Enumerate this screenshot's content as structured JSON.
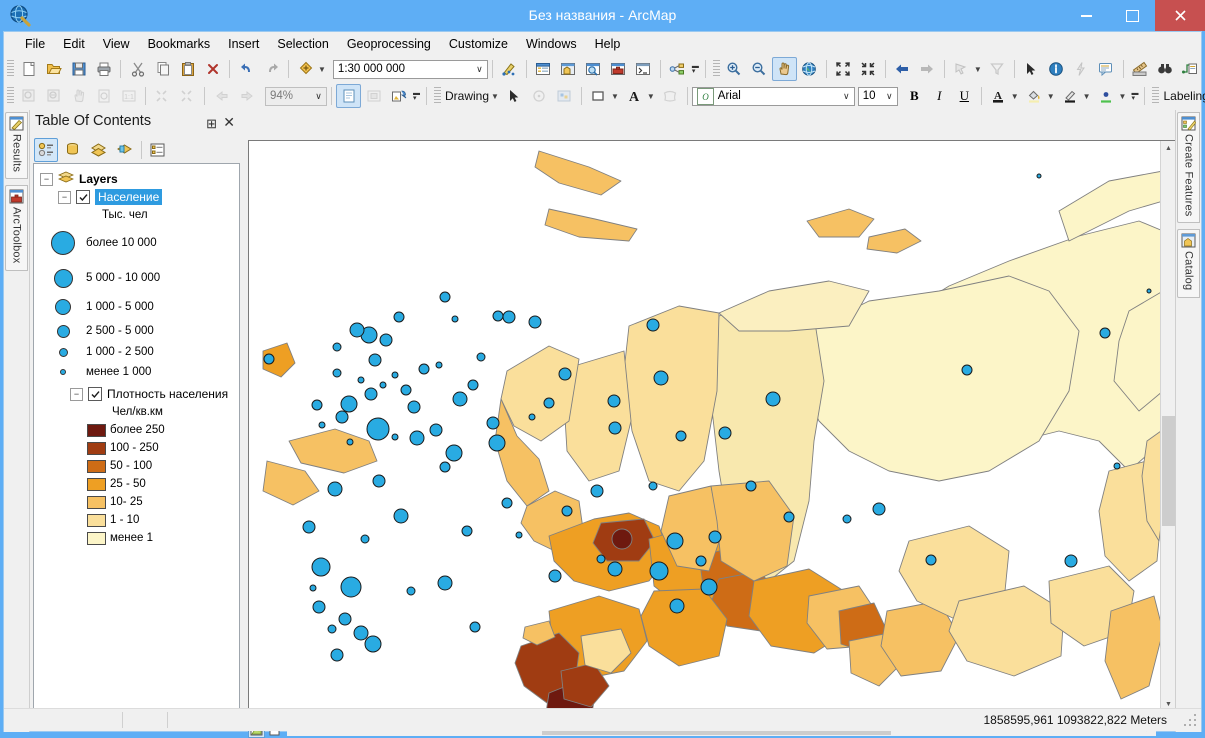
{
  "window": {
    "title": "Без названия - ArcMap",
    "app_icon": "arcmap-globe-icon",
    "minimize_label": "Minimize",
    "maximize_label": "Maximize",
    "close_label": "Close"
  },
  "menu": {
    "items": [
      {
        "label": "File",
        "name": "menu-file"
      },
      {
        "label": "Edit",
        "name": "menu-edit"
      },
      {
        "label": "View",
        "name": "menu-view"
      },
      {
        "label": "Bookmarks",
        "name": "menu-bookmarks"
      },
      {
        "label": "Insert",
        "name": "menu-insert"
      },
      {
        "label": "Selection",
        "name": "menu-selection"
      },
      {
        "label": "Geoprocessing",
        "name": "menu-geoprocessing"
      },
      {
        "label": "Customize",
        "name": "menu-customize"
      },
      {
        "label": "Windows",
        "name": "menu-windows"
      },
      {
        "label": "Help",
        "name": "menu-help"
      }
    ]
  },
  "standard_toolbar": {
    "scale": {
      "value": "1:30 000 000",
      "name": "map-scale-combo"
    },
    "buttons": [
      "new-document-icon",
      "open-icon",
      "save-icon",
      "print-icon",
      "cut-icon",
      "copy-icon",
      "paste-icon",
      "delete-icon",
      "undo-icon",
      "redo-icon",
      "add-data-icon",
      "editor-toolbar-icon",
      "table-of-contents-icon",
      "catalog-icon",
      "search-icon",
      "arctoolbox-icon",
      "python-window-icon",
      "model-builder-icon",
      "zoom-in-icon",
      "zoom-out-icon",
      "pan-icon",
      "full-extent-icon",
      "fixed-zoom-in-icon",
      "fixed-zoom-out-icon",
      "go-back-icon",
      "go-forward-icon",
      "select-features-icon",
      "select-by-polygon-icon",
      "clear-selection-icon",
      "select-elements-icon",
      "identify-icon",
      "hyperlink-icon",
      "html-popup-icon",
      "measure-icon",
      "find-icon",
      "find-route-icon",
      "go-to-xy-icon",
      "time-slider-icon",
      "create-viewer-window-icon"
    ]
  },
  "tools_toolbar": {
    "zoom_percent": {
      "value": "94%",
      "name": "zoom-percent-combo"
    },
    "drawing_label": "Drawing",
    "font_family": {
      "value": "Arial",
      "name": "font-family-combo"
    },
    "font_size": {
      "value": "10",
      "name": "font-size-combo"
    },
    "bold_label": "B",
    "italic_label": "I",
    "underline_label": "U",
    "labeling_label": "Labeling",
    "buttons": [
      "zoom-in-layout-icon",
      "zoom-out-layout-icon",
      "pan-layout-icon",
      "zoom-whole-page-icon",
      "zoom-100-icon",
      "fixed-zoom-in-layout-icon",
      "fixed-zoom-out-layout-icon",
      "go-back-layout-icon",
      "go-forward-layout-icon",
      "toggle-draft-mode-icon",
      "focus-data-frame-icon",
      "change-layout-icon",
      "select-elements-icon",
      "rotate-icon",
      "edit-vertices-icon",
      "new-rectangle-icon",
      "new-text-icon",
      "select-graphics-icon",
      "font-color-icon",
      "fill-color-icon",
      "line-color-icon",
      "marker-color-icon",
      "label-manager-icon"
    ]
  },
  "left_tabs": [
    {
      "label": "Results",
      "name": "tab-results",
      "icon": "results-icon"
    },
    {
      "label": "ArcToolbox",
      "name": "tab-arctoolbox",
      "icon": "arctoolbox-icon"
    }
  ],
  "right_tabs": [
    {
      "label": "Create Features",
      "name": "tab-create-features",
      "icon": "create-features-icon"
    },
    {
      "label": "Catalog",
      "name": "tab-catalog",
      "icon": "catalog-icon"
    }
  ],
  "toc": {
    "title": "Table Of Contents",
    "pin_icon": "pin-icon",
    "close_icon": "close-icon",
    "tools": [
      {
        "name": "list-by-drawing-order-button",
        "label": "List By Drawing Order",
        "selected": true
      },
      {
        "name": "list-by-source-button",
        "label": "List By Source",
        "selected": false
      },
      {
        "name": "list-by-visibility-button",
        "label": "List By Visibility",
        "selected": false
      },
      {
        "name": "list-by-selection-button",
        "label": "List By Selection",
        "selected": false
      },
      {
        "name": "toc-options-button",
        "label": "Options",
        "selected": false
      }
    ],
    "root": "Layers",
    "layers": [
      {
        "name": "Население",
        "selected": true,
        "checked": true,
        "unit": "Тыс. чел",
        "symbol_type": "graduated-circles",
        "classes": [
          {
            "label": "более 10 000",
            "size": 22
          },
          {
            "label": "5 000 - 10 000",
            "size": 17
          },
          {
            "label": "1 000 - 5 000",
            "size": 14
          },
          {
            "label": "2 500 - 5 000",
            "size": 11
          },
          {
            "label": "1 000 - 2 500",
            "size": 7
          },
          {
            "label": "менее 1 000",
            "size": 4
          }
        ],
        "symbol_color": "#29ABE2"
      },
      {
        "name": "Плотность населения",
        "selected": false,
        "checked": true,
        "unit": "Чел/кв.км",
        "symbol_type": "graduated-colors",
        "classes": [
          {
            "label": "более 250",
            "color": "#6E190F"
          },
          {
            "label": "100 - 250",
            "color": "#A03C12"
          },
          {
            "label": "50 - 100",
            "color": "#CE6C16"
          },
          {
            "label": "25 - 50",
            "color": "#EE9F23"
          },
          {
            "label": "10- 25",
            "color": "#F6C163"
          },
          {
            "label": "1 - 10",
            "color": "#FADF9B"
          },
          {
            "label": "менее 1",
            "color": "#FCF5C8"
          }
        ]
      }
    ]
  },
  "map_tools": [
    {
      "name": "data-view-button",
      "icon": "data-view-icon",
      "active": true
    },
    {
      "name": "layout-view-button",
      "icon": "layout-view-icon",
      "active": false
    },
    {
      "name": "refresh-view-button",
      "icon": "refresh-icon",
      "active": false
    },
    {
      "name": "pause-drawing-button",
      "icon": "pause-icon",
      "active": false
    },
    {
      "name": "toggle-panel-button",
      "icon": "chevron-left-icon",
      "active": false
    }
  ],
  "status": {
    "coordinates": "1858595,961  1093822,822 Meters"
  },
  "map": {
    "ocean_color": "#FFFFFF",
    "border_color": "#808080",
    "symbol_fill": "#29ABE2",
    "symbol_outline": "#222222",
    "fill_palette": [
      "#6E190F",
      "#A03C12",
      "#CE6C16",
      "#EE9F23",
      "#F6C163",
      "#FADF9B",
      "#FCF5C8"
    ]
  }
}
